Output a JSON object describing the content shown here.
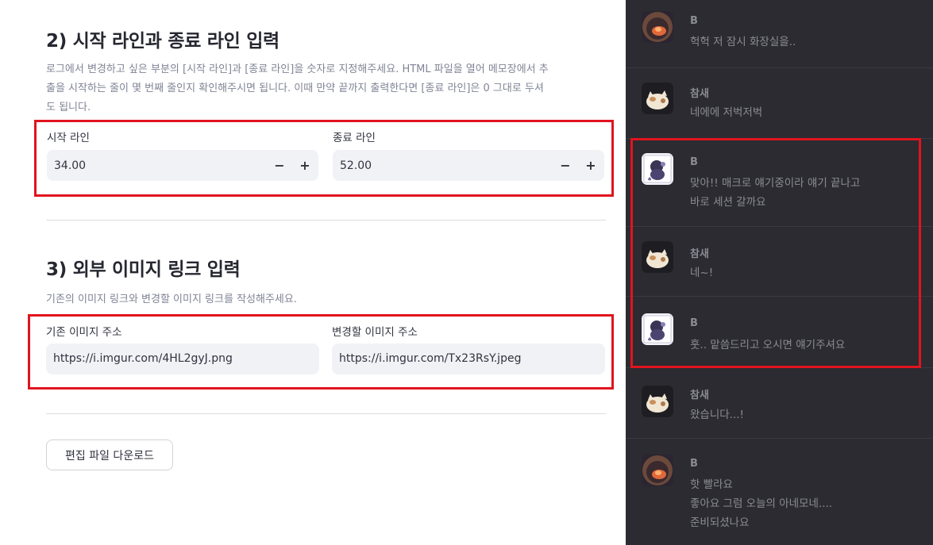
{
  "form": {
    "section2": {
      "title": "2) 시작 라인과 종료 라인 입력",
      "desc_lines": [
        "로그에서 변경하고 싶은 부분의 [시작 라인]과 [종료 라인]을 숫자로 지정해주세요. HTML 파일을 열어 메모장에서 추",
        "출을 시작하는 줄이 몇 번째 줄인지 확인해주시면 됩니다. 이때 만약 끝까지 출력한다면 [종료 라인]은 0 그대로 두셔",
        "도 됩니다."
      ],
      "start_label": "시작 라인",
      "start_value": "34.00",
      "end_label": "종료 라인",
      "end_value": "52.00",
      "minus": "−",
      "plus": "+"
    },
    "section3": {
      "title": "3) 외부 이미지 링크 입력",
      "desc": "기존의 이미지 링크와 변경할 이미지 링크를 작성해주세요.",
      "orig_label": "기존 이미지 주소",
      "orig_value": "https://i.imgur.com/4HL2gyJ.png",
      "new_label": "변경할 이미지 주소",
      "new_value": "https://i.imgur.com/Tx23RsY.jpeg"
    },
    "download_label": "편집 파일 다운로드"
  },
  "chat": [
    {
      "name": "B",
      "avatar": "orange-glow-avatar",
      "lines": [
        "헉헉 저 잠시 화장실을.."
      ]
    },
    {
      "name": "참새",
      "avatar": "cream-cat-avatar",
      "lines": [
        "네에에 저벅저벅"
      ]
    },
    {
      "name": "B",
      "avatar": "card-character-avatar",
      "lines": [
        "맞아!! 매크로 얘기중이라 얘기 끝나고",
        "바로 세션 갈까요"
      ]
    },
    {
      "name": "참새",
      "avatar": "cream-cat-avatar",
      "lines": [
        "네~!"
      ]
    },
    {
      "name": "B",
      "avatar": "card-character-avatar",
      "lines": [
        "훗.. 맡씀드리고 오시면 얘기주셔요"
      ]
    },
    {
      "name": "참새",
      "avatar": "cream-cat-avatar",
      "lines": [
        "왔습니다...!"
      ]
    },
    {
      "name": "B",
      "avatar": "orange-glow-avatar",
      "lines": [
        "핫 빨라요",
        "좋아요 그럼 오늘의 아네모네....",
        "준비되셨나요"
      ]
    }
  ],
  "colors": {
    "highlight": "#e0141e",
    "chat_bg": "#2b2b31",
    "input_bg": "#f0f2f6"
  }
}
